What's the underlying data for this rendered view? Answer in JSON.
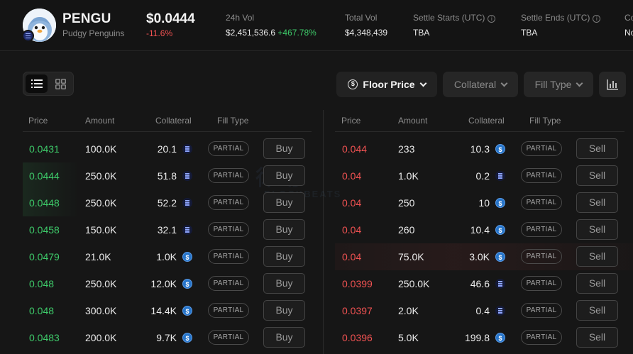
{
  "header": {
    "symbol": "PENGU",
    "name": "Pudgy Penguins",
    "price": "$0.0444",
    "change": "-11.6%",
    "stats": [
      {
        "label": "24h Vol",
        "value": "$2,451,536.6",
        "extra": "+467.78%"
      },
      {
        "label": "Total Vol",
        "value": "$4,348,439"
      },
      {
        "label": "Settle Starts (UTC)",
        "value": "TBA",
        "info": true
      },
      {
        "label": "Settle Ends (UTC)",
        "value": "TBA",
        "info": true
      },
      {
        "label": "Co",
        "value": "No"
      }
    ]
  },
  "toolbar": {
    "floor_price": "Floor Price",
    "collateral": "Collateral",
    "fill_type": "Fill Type",
    "list_view_icon": "list-icon",
    "grid_view_icon": "grid-icon",
    "chart_icon": "chart-icon"
  },
  "buy_table": {
    "headers": [
      "Price",
      "Amount",
      "Collateral",
      "Fill Type"
    ],
    "rows": [
      {
        "price": "0.0431",
        "amount": "100.0K",
        "collateral": "20.1",
        "token": "eth",
        "fill": "PARTIAL",
        "action": "Buy"
      },
      {
        "price": "0.0444",
        "amount": "250.0K",
        "collateral": "51.8",
        "token": "eth",
        "fill": "PARTIAL",
        "action": "Buy"
      },
      {
        "price": "0.0448",
        "amount": "250.0K",
        "collateral": "52.2",
        "token": "eth",
        "fill": "PARTIAL",
        "action": "Buy"
      },
      {
        "price": "0.0458",
        "amount": "150.0K",
        "collateral": "32.1",
        "token": "eth",
        "fill": "PARTIAL",
        "action": "Buy"
      },
      {
        "price": "0.0479",
        "amount": "21.0K",
        "collateral": "1.0K",
        "token": "usdc",
        "fill": "PARTIAL",
        "action": "Buy"
      },
      {
        "price": "0.048",
        "amount": "250.0K",
        "collateral": "12.0K",
        "token": "usdc",
        "fill": "PARTIAL",
        "action": "Buy"
      },
      {
        "price": "0.048",
        "amount": "300.0K",
        "collateral": "14.4K",
        "token": "usdc",
        "fill": "PARTIAL",
        "action": "Buy"
      },
      {
        "price": "0.0483",
        "amount": "200.0K",
        "collateral": "9.7K",
        "token": "usdc",
        "fill": "PARTIAL",
        "action": "Buy"
      }
    ]
  },
  "sell_table": {
    "headers": [
      "Price",
      "Amount",
      "Collateral",
      "Fill Type"
    ],
    "rows": [
      {
        "price": "0.044",
        "amount": "233",
        "collateral": "10.3",
        "token": "usdc",
        "fill": "PARTIAL",
        "action": "Sell"
      },
      {
        "price": "0.04",
        "amount": "1.0K",
        "collateral": "0.2",
        "token": "eth",
        "fill": "PARTIAL",
        "action": "Sell"
      },
      {
        "price": "0.04",
        "amount": "250",
        "collateral": "10",
        "token": "usdc",
        "fill": "PARTIAL",
        "action": "Sell"
      },
      {
        "price": "0.04",
        "amount": "260",
        "collateral": "10.4",
        "token": "usdc",
        "fill": "PARTIAL",
        "action": "Sell"
      },
      {
        "price": "0.04",
        "amount": "75.0K",
        "collateral": "3.0K",
        "token": "usdc",
        "fill": "PARTIAL",
        "action": "Sell"
      },
      {
        "price": "0.0399",
        "amount": "250.0K",
        "collateral": "46.6",
        "token": "eth",
        "fill": "PARTIAL",
        "action": "Sell"
      },
      {
        "price": "0.0397",
        "amount": "2.0K",
        "collateral": "0.4",
        "token": "eth",
        "fill": "PARTIAL",
        "action": "Sell"
      },
      {
        "price": "0.0396",
        "amount": "5.0K",
        "collateral": "199.8",
        "token": "usdc",
        "fill": "PARTIAL",
        "action": "Sell"
      }
    ]
  },
  "watermark": {
    "main": "律动",
    "sub": "BLOCKBEATS"
  },
  "colors": {
    "buy": "#3ecb6a",
    "sell": "#f05252",
    "background": "#161616"
  }
}
